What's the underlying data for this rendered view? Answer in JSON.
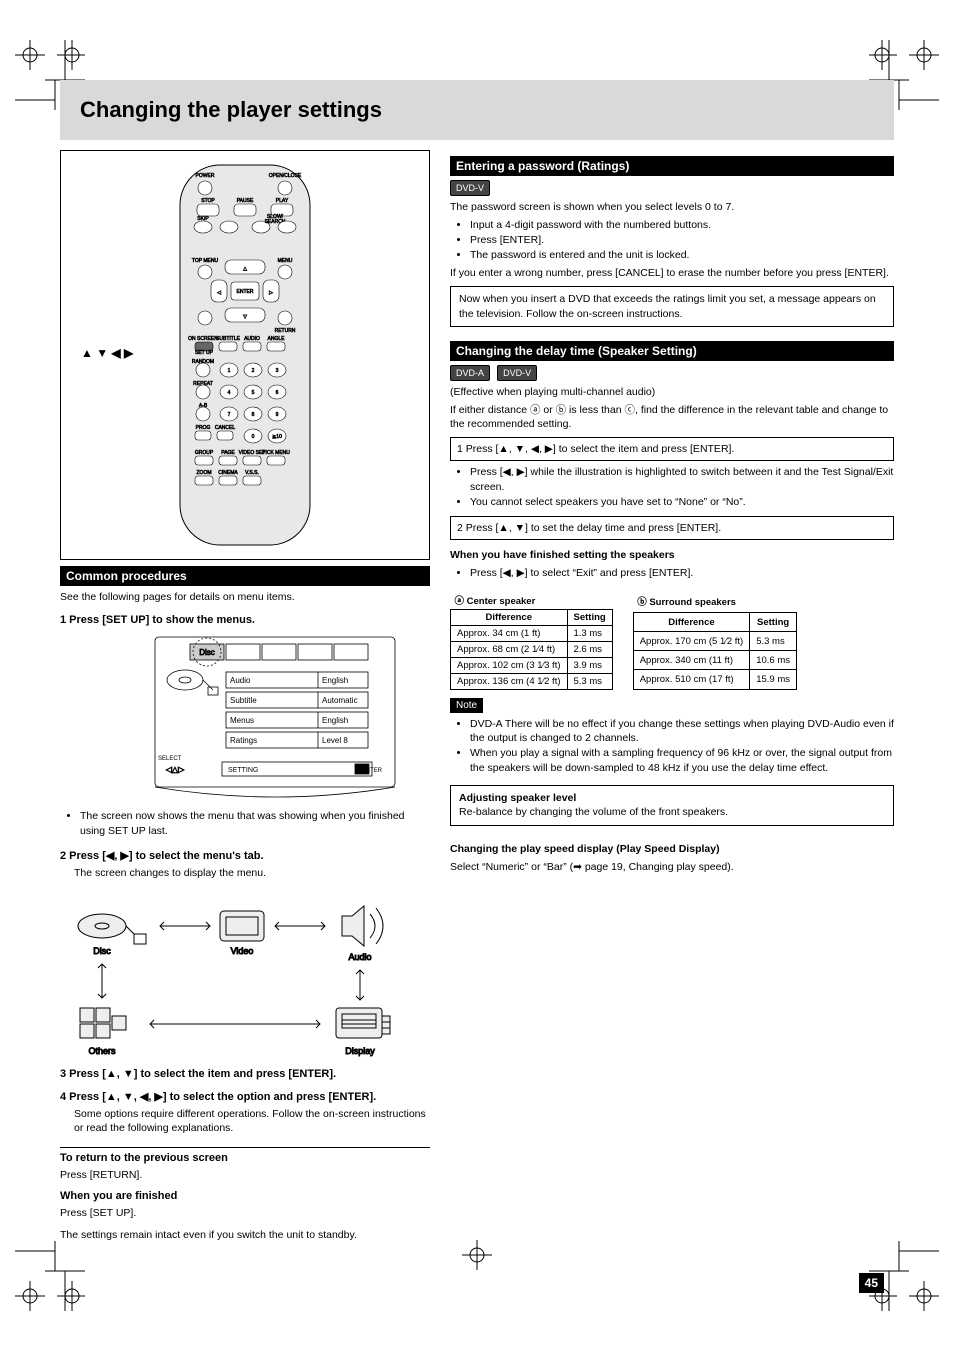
{
  "title": "Changing the player settings",
  "arrowLabel": "▲ ▼ ◀ ▶",
  "left": {
    "bar": "Common procedures",
    "intro": "See the following pages for details on menu items.",
    "step1_h": "1 Press [SET UP] to show the menus.",
    "tv_box": {
      "tab": "Disc",
      "menu_items": [
        "Audio",
        "Subtitle",
        "Menus",
        "Ratings"
      ],
      "menu_values": [
        "English",
        "Automatic",
        "English",
        "Level 8"
      ],
      "select_label": "SELECT",
      "setting_label": "SETTING",
      "enter_label": "ENTER"
    },
    "step1_note": "The screen now shows the menu that was showing when you finished using SET UP last.",
    "step2_h": "2 Press [◀, ▶] to select the menu's tab.",
    "step2_note": "The screen changes to display the menu.",
    "labels": [
      "Disc",
      "Video",
      "Audio",
      "Others",
      "Display"
    ],
    "step3_h": "3 Press [▲, ▼] to select the item and press [ENTER].",
    "step4_h": "4 Press [▲, ▼, ◀, ▶] to select the option and press [ENTER].",
    "step4_note": "Some options require different operations. Follow the on-screen instructions or read the following explanations.",
    "return_h": "To return to the previous screen",
    "return_body": "Press [RETURN].",
    "finished_h": "When you are finished",
    "finished_body": "Press [SET UP].",
    "footer_note": "The settings remain intact even if you switch the unit to standby."
  },
  "right": {
    "ratings_bar": "Entering a password (Ratings)",
    "ratings_p1": "The password screen is shown when you select levels 0 to 7.",
    "ratings_l1": "Input a 4-digit password with the numbered buttons.",
    "ratings_l2": "Press [ENTER].",
    "ratings_after": "The password is entered and the unit is locked.",
    "ratings_forget": "If you enter a wrong number, press [CANCEL] to erase the number before you press [ENTER].",
    "ratings_box": "Now when you insert a DVD that exceeds the ratings limit you set, a message appears on the television. Follow the on-screen instructions.",
    "sp_bar": "Changing the delay time (Speaker Setting)",
    "sp_p1": "(Effective when playing multi-channel audio)",
    "sp_p2": "If either distance ⓐ or ⓑ is less than ⓒ, find the difference in the relevant table and change to the recommended setting.",
    "sp_step1": "1 Press [▲, ▼, ◀, ▶] to select the item and press [ENTER].",
    "sp_bullet1": "Press [◀, ▶] while the illustration is highlighted to switch between it and the Test Signal/Exit screen.",
    "sp_bullet2": "You cannot select speakers you have set to “None” or “No”.",
    "sp_step2": "2 Press [▲, ▼] to set the delay time and press [ENTER].",
    "sp_finish_h": "When you have finished setting the speakers",
    "sp_finish_body": "Press [◀, ▶] to select “Exit” and press [ENTER].",
    "note_label": "Note",
    "note_items": [
      "DVD‑A  There will be no effect if you change these settings when playing DVD‑Audio even if the output is changed to 2 channels.",
      "When you play a signal with a sampling frequency of 96 kHz or over, the signal output from the speakers will be down‑sampled to 48 kHz if you use the delay time effect."
    ],
    "balance_h": "Adjusting speaker level",
    "balance_body": "Re‑balance by changing the volume of the front speakers.",
    "speed_h": "Changing the play speed display (Play Speed Display)",
    "speed_body": "Select “Numeric” or “Bar” (➡ page 19, Changing play speed).",
    "tables": {
      "centerTitle": "ⓐ Center speaker",
      "surroundTitle": "ⓑ Surround speakers",
      "cols": [
        "Difference",
        "Setting"
      ],
      "centerRows": [
        [
          "Approx. 34 cm (1 ft)",
          "1.3 ms"
        ],
        [
          "Approx. 68 cm (2 1⁄4 ft)",
          "2.6 ms"
        ],
        [
          "Approx. 102 cm (3 1⁄3 ft)",
          "3.9 ms"
        ],
        [
          "Approx. 136 cm (4 1⁄2 ft)",
          "5.3 ms"
        ]
      ],
      "surroundRows": [
        [
          "Approx. 170 cm (5 1⁄2 ft)",
          "5.3 ms"
        ],
        [
          "Approx. 340 cm (11 ft)",
          "10.6 ms"
        ],
        [
          "Approx. 510 cm (17 ft)",
          "15.9 ms"
        ]
      ]
    }
  },
  "pageNumber": "45"
}
